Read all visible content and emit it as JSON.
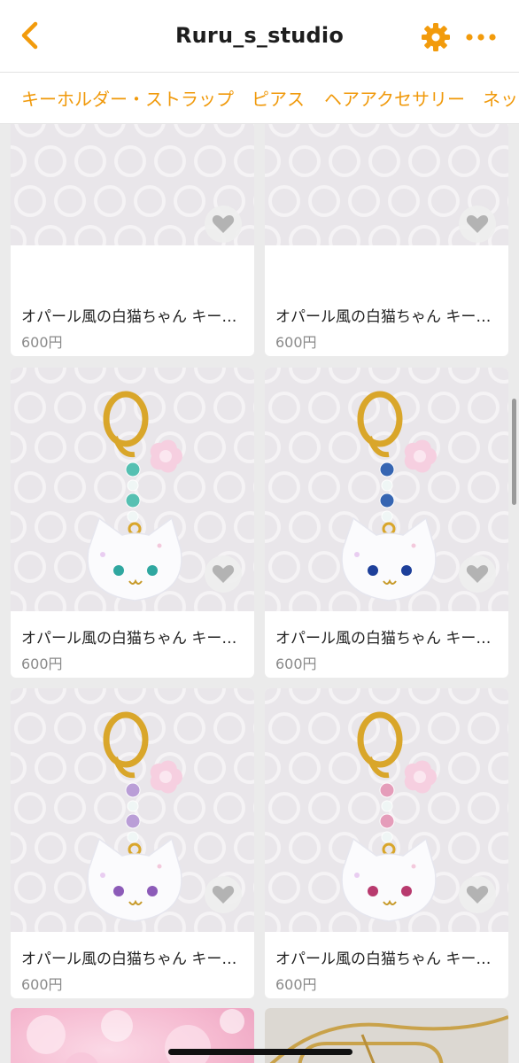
{
  "header": {
    "title": "Ruru_s_studio",
    "back_icon": "chevron-left-icon",
    "settings_icon": "gear-icon",
    "more_icon": "ellipsis-icon",
    "accent_color": "#f29b0c"
  },
  "tabs": [
    {
      "label": "キーホルダー・ストラップ"
    },
    {
      "label": "ピアス"
    },
    {
      "label": "ヘアアクセサリー"
    },
    {
      "label": "ネッ"
    }
  ],
  "products": [
    {
      "name": "オパール風の白猫ちゃん キー…",
      "price": "600円",
      "eye_color": "#3aa86a",
      "bead_color": "#5fc77d",
      "favorite_icon": "heart-icon"
    },
    {
      "name": "オパール風の白猫ちゃん キー…",
      "price": "600円",
      "eye_color": "#2f9e5a",
      "bead_color": "#6bcc66",
      "favorite_icon": "heart-icon"
    },
    {
      "name": "オパール風の白猫ちゃん キー…",
      "price": "600円",
      "eye_color": "#2fa7a0",
      "bead_color": "#4fbfb0",
      "favorite_icon": "heart-icon"
    },
    {
      "name": "オパール風の白猫ちゃん キー…",
      "price": "600円",
      "eye_color": "#1d3f9a",
      "bead_color": "#2d5fb0",
      "favorite_icon": "heart-icon"
    },
    {
      "name": "オパール風の白猫ちゃん キー…",
      "price": "600円",
      "eye_color": "#8c5bb8",
      "bead_color": "#b89bd6",
      "favorite_icon": "heart-icon"
    },
    {
      "name": "オパール風の白猫ちゃん キー…",
      "price": "600円",
      "eye_color": "#b83a6e",
      "bead_color": "#e59ab8",
      "favorite_icon": "heart-icon"
    }
  ]
}
